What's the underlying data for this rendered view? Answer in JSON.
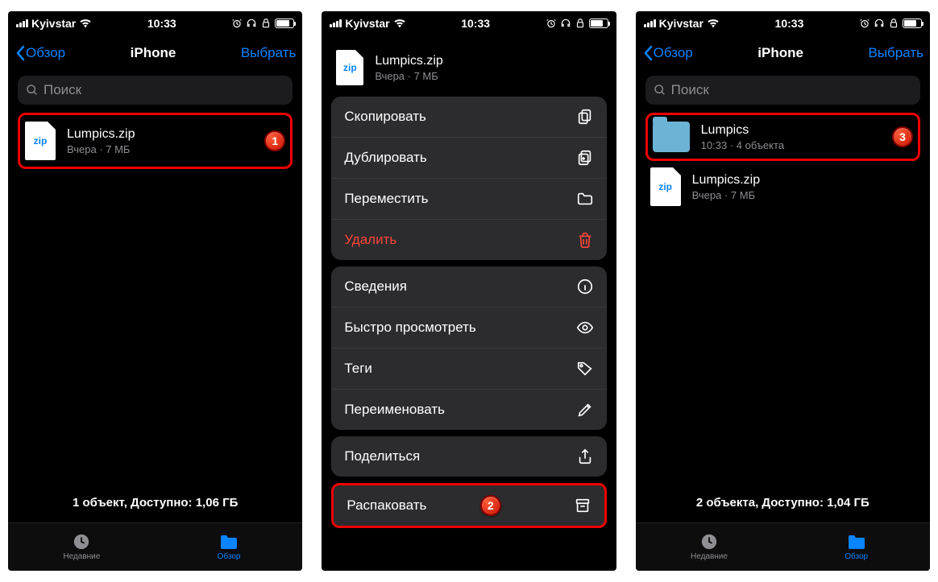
{
  "status": {
    "carrier": "Kyivstar",
    "time": "10:33"
  },
  "nav": {
    "back": "Обзор",
    "title": "iPhone",
    "action": "Выбрать"
  },
  "search": {
    "placeholder": "Поиск"
  },
  "zip_ext": "zip",
  "screen1": {
    "file": {
      "name": "Lumpics.zip",
      "meta": "Вчера · 7 МБ"
    },
    "footer": "1 объект, Доступно: 1,06 ГБ",
    "badge": "1"
  },
  "screen2": {
    "header": {
      "name": "Lumpics.zip",
      "meta": "Вчера · 7 МБ"
    },
    "menu": {
      "copy": "Скопировать",
      "duplicate": "Дублировать",
      "move": "Переместить",
      "delete": "Удалить",
      "info": "Сведения",
      "quicklook": "Быстро просмотреть",
      "tags": "Теги",
      "rename": "Переименовать",
      "share": "Поделиться",
      "uncompress": "Распаковать"
    },
    "badge": "2"
  },
  "screen3": {
    "folder": {
      "name": "Lumpics",
      "meta": "10:33 · 4 объекта"
    },
    "file": {
      "name": "Lumpics.zip",
      "meta": "Вчера · 7 МБ"
    },
    "footer": "2 объекта, Доступно: 1,04 ГБ",
    "badge": "3"
  },
  "tabs": {
    "recents": "Недавние",
    "browse": "Обзор"
  }
}
